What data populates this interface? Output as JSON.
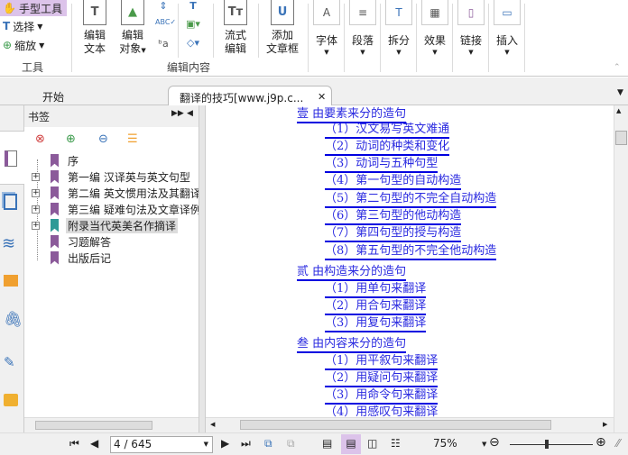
{
  "ribbon": {
    "tools": {
      "hand": "手型工具",
      "select": "选择",
      "zoom": "缩放",
      "group": "工具"
    },
    "edit": {
      "edit_text": [
        "编辑",
        "文本"
      ],
      "edit_object": [
        "编辑",
        "对象"
      ],
      "flow_edit": [
        "流式",
        "编辑"
      ],
      "add_article": [
        "添加",
        "文章框"
      ],
      "group": "编辑内容"
    },
    "format": [
      {
        "label": "字体",
        "icon": "A"
      },
      {
        "label": "段落",
        "icon": "≡"
      },
      {
        "label": "拆分",
        "icon": "T"
      },
      {
        "label": "效果",
        "icon": "▦"
      },
      {
        "label": "链接",
        "icon": "▯"
      },
      {
        "label": "插入",
        "icon": "▭"
      }
    ]
  },
  "tabs": [
    {
      "label": "开始"
    },
    {
      "label": "翻译的技巧[www.j9p.c..."
    }
  ],
  "bookmarks": {
    "title": "书签",
    "items": [
      {
        "label": "序",
        "expandable": false
      },
      {
        "label": "第一编 汉译英与英文句型",
        "expandable": true
      },
      {
        "label": "第二编 英文惯用法及其翻译",
        "expandable": true
      },
      {
        "label": "第三编 疑难句法及文章译例",
        "expandable": true
      },
      {
        "label": "附录当代英美名作摘译",
        "expandable": true,
        "selected": true
      },
      {
        "label": "习题解答",
        "expandable": false
      },
      {
        "label": "出版后记",
        "expandable": false
      }
    ]
  },
  "document": {
    "sections": [
      {
        "title": "壹  由要素来分的造句",
        "items": [
          "（1）汉文易写英文难通",
          "（2）动词的种类和变化",
          "（3）动词与五种句型",
          "（4）第一句型的自动构造",
          "（5）第二句型的不完全自动构造",
          "（6）第三句型的他动构造",
          "（7）第四句型的授与构造",
          "（8）第五句型的不完全他动构造"
        ]
      },
      {
        "title": "贰  由构造来分的造句",
        "items": [
          "（1）用单句来翻译",
          "（2）用合句来翻译",
          "（3）用复句来翻译"
        ]
      },
      {
        "title": "叁  由内容来分的造句",
        "items": [
          "（1）用平叙句来翻译",
          "（2）用疑问句来翻译",
          "（3）用命令句来翻译",
          "（4）用感叹句来翻译"
        ]
      }
    ]
  },
  "status": {
    "page": "4 / 645",
    "zoom": "75%",
    "zoom_slider": 0.45
  },
  "colors": {
    "accent": "#dcc3ea",
    "link": "#2a2ae0",
    "bookmark": "#8b5a9a",
    "bookmark_selected": "#2e9a96"
  }
}
